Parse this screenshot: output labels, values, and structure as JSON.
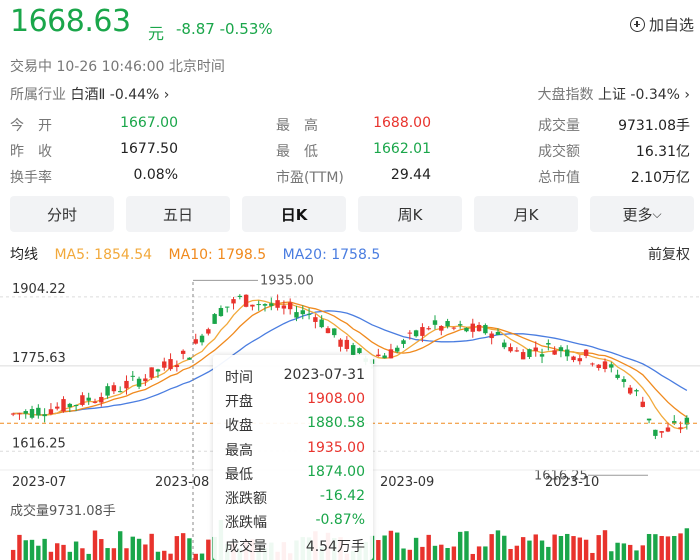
{
  "quote": {
    "price": "1668.63",
    "unit": "元",
    "change": "-8.87 -0.53%",
    "watch_label": "加自选"
  },
  "status": {
    "state": "交易中",
    "datetime": "10-26 10:46:00",
    "tz": "北京时间"
  },
  "industry": {
    "label": "所属行业",
    "name": "白酒Ⅱ",
    "change": "-0.44%",
    "arrow": "›"
  },
  "index": {
    "label": "大盘指数",
    "name": "上证",
    "change": "-0.34%",
    "arrow": "›"
  },
  "stats": [
    {
      "l1": "今　开",
      "v1": "1667.00",
      "c1": "#1aa64a",
      "l2": "最　高",
      "v2": "1688.00",
      "c2": "#e8332d",
      "l3": "成交量",
      "v3": "9731.08手"
    },
    {
      "l1": "昨　收",
      "v1": "1677.50",
      "c1": "#222222",
      "l2": "最　低",
      "v2": "1662.01",
      "c2": "#1aa64a",
      "l3": "成交额",
      "v3": "16.31亿"
    },
    {
      "l1": "换手率",
      "v1": "0.08%",
      "c1": "#222222",
      "l2": "市盈(TTM)",
      "v2": "29.44",
      "c2": "#222222",
      "l3": "总市值",
      "v3": "2.10万亿"
    }
  ],
  "tabs": [
    {
      "label": "分时",
      "active": false
    },
    {
      "label": "五日",
      "active": false
    },
    {
      "label": "日K",
      "active": true
    },
    {
      "label": "周K",
      "active": false
    },
    {
      "label": "月K",
      "active": false
    },
    {
      "label": "更多",
      "active": false
    }
  ],
  "ma": {
    "title": "均线",
    "ma5": "MA5: 1854.54",
    "ma10": "MA10: 1798.5",
    "ma20": "MA20: 1758.5",
    "fuquan": "前复权",
    "colors": {
      "ma5": "#f2a93b",
      "ma10": "#f08a1e",
      "ma20": "#4a7de0"
    }
  },
  "chart_data": {
    "type": "candlestick",
    "y_ticks": [
      "1904.22",
      "1775.63",
      "1616.25"
    ],
    "x_ticks": [
      "2023-07",
      "2023-08",
      "2023-09",
      "2023-10"
    ],
    "highlighted_x": "2023-07-31",
    "max_marker": "1935.00",
    "min_marker": "1616.25",
    "current_price": 1668.63,
    "ylim": [
      1600,
      1945
    ],
    "up_color": "#e8332d",
    "down_color": "#1aa64a",
    "volume_label": "成交量9731.08手"
  },
  "tooltip": {
    "rows": [
      {
        "label": "时间",
        "value": "2023-07-31",
        "color": "#333333"
      },
      {
        "label": "开盘",
        "value": "1908.00",
        "color": "#e8332d"
      },
      {
        "label": "收盘",
        "value": "1880.58",
        "color": "#1aa64a"
      },
      {
        "label": "最高",
        "value": "1935.00",
        "color": "#e8332d"
      },
      {
        "label": "最低",
        "value": "1874.00",
        "color": "#1aa64a"
      },
      {
        "label": "涨跌额",
        "value": "-16.42",
        "color": "#1aa64a"
      },
      {
        "label": "涨跌幅",
        "value": "-0.87%",
        "color": "#1aa64a"
      },
      {
        "label": "成交量",
        "value": "4.54万手",
        "color": "#333333"
      }
    ]
  }
}
